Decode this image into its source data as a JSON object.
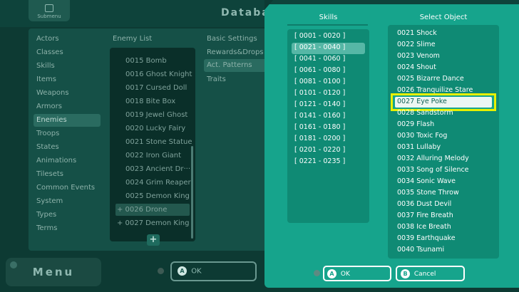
{
  "background": {
    "submenu_label": "Submenu",
    "title": "Database",
    "categories": [
      "Actors",
      "Classes",
      "Skills",
      "Items",
      "Weapons",
      "Armors",
      "Enemies",
      "Troops",
      "States",
      "Animations",
      "Tilesets",
      "Common Events",
      "System",
      "Types",
      "Terms"
    ],
    "selected_category": "Enemies",
    "enemy_list_header": "Enemy List",
    "enemies": [
      "0015 Bomb",
      "0016 Ghost Knight",
      "0017 Cursed Doll",
      "0018 Bite Box",
      "0019 Jewel Ghost",
      "0020 Lucky Fairy",
      "0021 Stone Statue",
      "0022 Iron Giant",
      "0023 Ancient Dr···",
      "0024 Grim Reaper",
      "0025 Demon King",
      "+ 0026 Drone",
      "+ 0027 Demon King"
    ],
    "enemy_tabs": [
      "Basic Settings",
      "Rewards&Drops",
      "Act. Patterns",
      "Traits"
    ],
    "add_symbol": "+",
    "menu_label": "Menu",
    "ok_label": "OK",
    "ok_key": "A"
  },
  "dialog": {
    "skills_title": "Skills",
    "skill_ranges": [
      "[ 0001 - 0020 ]",
      "[ 0021 - 0040 ]",
      "[ 0041 - 0060 ]",
      "[ 0061 - 0080 ]",
      "[ 0081 - 0100 ]",
      "[ 0101 - 0120 ]",
      "[ 0121 - 0140 ]",
      "[ 0141 - 0160 ]",
      "[ 0161 - 0180 ]",
      "[ 0181 - 0200 ]",
      "[ 0201 - 0220 ]",
      "[ 0221 - 0235 ]"
    ],
    "selected_range": "[ 0021 - 0040 ]",
    "object_title": "Select Object",
    "objects": [
      "0021 Shock",
      "0022 Slime",
      "0023 Venom",
      "0024 Shout",
      "0025 Bizarre Dance",
      "0026 Tranquilize Stare",
      "0027 Eye Poke",
      "0028 Sandstorm",
      "0029 Flash",
      "0030 Toxic Fog",
      "0031 Lullaby",
      "0032 Alluring Melody",
      "0033 Song of Silence",
      "0034 Sonic Wave",
      "0035 Stone Throw",
      "0036 Dust Devil",
      "0037 Fire Breath",
      "0038 Ice Breath",
      "0039 Earthquake",
      "0040 Tsunami"
    ],
    "selected_object": "0027 Eye Poke",
    "ok_label": "OK",
    "ok_key": "A",
    "cancel_label": "Cancel",
    "cancel_key": "B"
  }
}
